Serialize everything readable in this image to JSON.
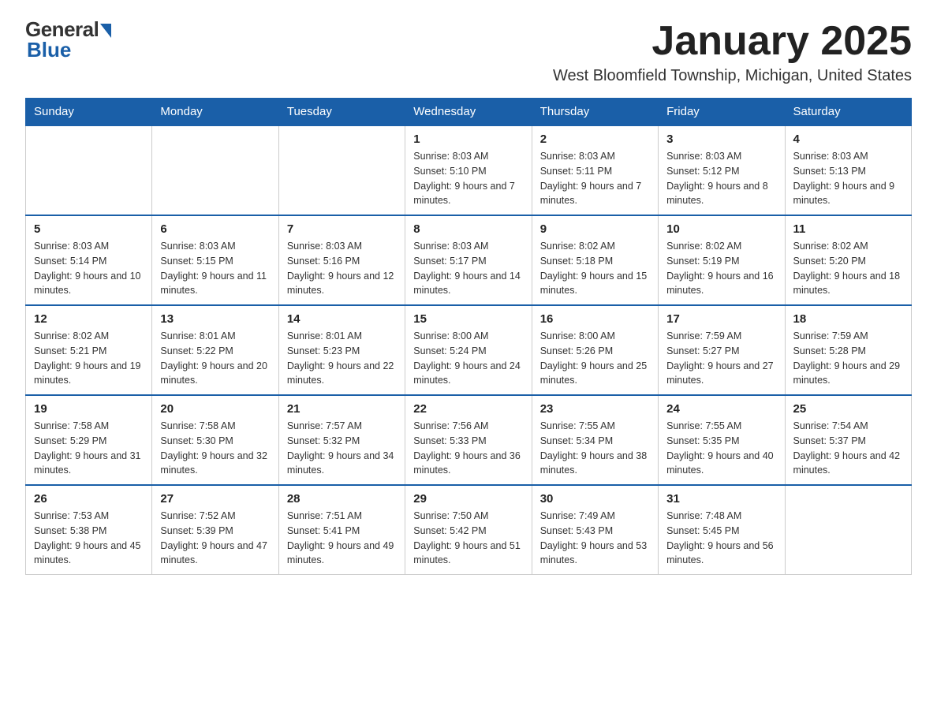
{
  "logo": {
    "general": "General",
    "blue": "Blue"
  },
  "header": {
    "month_title": "January 2025",
    "location": "West Bloomfield Township, Michigan, United States"
  },
  "days_of_week": [
    "Sunday",
    "Monday",
    "Tuesday",
    "Wednesday",
    "Thursday",
    "Friday",
    "Saturday"
  ],
  "weeks": [
    [
      {
        "day": "",
        "info": ""
      },
      {
        "day": "",
        "info": ""
      },
      {
        "day": "",
        "info": ""
      },
      {
        "day": "1",
        "info": "Sunrise: 8:03 AM\nSunset: 5:10 PM\nDaylight: 9 hours and 7 minutes."
      },
      {
        "day": "2",
        "info": "Sunrise: 8:03 AM\nSunset: 5:11 PM\nDaylight: 9 hours and 7 minutes."
      },
      {
        "day": "3",
        "info": "Sunrise: 8:03 AM\nSunset: 5:12 PM\nDaylight: 9 hours and 8 minutes."
      },
      {
        "day": "4",
        "info": "Sunrise: 8:03 AM\nSunset: 5:13 PM\nDaylight: 9 hours and 9 minutes."
      }
    ],
    [
      {
        "day": "5",
        "info": "Sunrise: 8:03 AM\nSunset: 5:14 PM\nDaylight: 9 hours and 10 minutes."
      },
      {
        "day": "6",
        "info": "Sunrise: 8:03 AM\nSunset: 5:15 PM\nDaylight: 9 hours and 11 minutes."
      },
      {
        "day": "7",
        "info": "Sunrise: 8:03 AM\nSunset: 5:16 PM\nDaylight: 9 hours and 12 minutes."
      },
      {
        "day": "8",
        "info": "Sunrise: 8:03 AM\nSunset: 5:17 PM\nDaylight: 9 hours and 14 minutes."
      },
      {
        "day": "9",
        "info": "Sunrise: 8:02 AM\nSunset: 5:18 PM\nDaylight: 9 hours and 15 minutes."
      },
      {
        "day": "10",
        "info": "Sunrise: 8:02 AM\nSunset: 5:19 PM\nDaylight: 9 hours and 16 minutes."
      },
      {
        "day": "11",
        "info": "Sunrise: 8:02 AM\nSunset: 5:20 PM\nDaylight: 9 hours and 18 minutes."
      }
    ],
    [
      {
        "day": "12",
        "info": "Sunrise: 8:02 AM\nSunset: 5:21 PM\nDaylight: 9 hours and 19 minutes."
      },
      {
        "day": "13",
        "info": "Sunrise: 8:01 AM\nSunset: 5:22 PM\nDaylight: 9 hours and 20 minutes."
      },
      {
        "day": "14",
        "info": "Sunrise: 8:01 AM\nSunset: 5:23 PM\nDaylight: 9 hours and 22 minutes."
      },
      {
        "day": "15",
        "info": "Sunrise: 8:00 AM\nSunset: 5:24 PM\nDaylight: 9 hours and 24 minutes."
      },
      {
        "day": "16",
        "info": "Sunrise: 8:00 AM\nSunset: 5:26 PM\nDaylight: 9 hours and 25 minutes."
      },
      {
        "day": "17",
        "info": "Sunrise: 7:59 AM\nSunset: 5:27 PM\nDaylight: 9 hours and 27 minutes."
      },
      {
        "day": "18",
        "info": "Sunrise: 7:59 AM\nSunset: 5:28 PM\nDaylight: 9 hours and 29 minutes."
      }
    ],
    [
      {
        "day": "19",
        "info": "Sunrise: 7:58 AM\nSunset: 5:29 PM\nDaylight: 9 hours and 31 minutes."
      },
      {
        "day": "20",
        "info": "Sunrise: 7:58 AM\nSunset: 5:30 PM\nDaylight: 9 hours and 32 minutes."
      },
      {
        "day": "21",
        "info": "Sunrise: 7:57 AM\nSunset: 5:32 PM\nDaylight: 9 hours and 34 minutes."
      },
      {
        "day": "22",
        "info": "Sunrise: 7:56 AM\nSunset: 5:33 PM\nDaylight: 9 hours and 36 minutes."
      },
      {
        "day": "23",
        "info": "Sunrise: 7:55 AM\nSunset: 5:34 PM\nDaylight: 9 hours and 38 minutes."
      },
      {
        "day": "24",
        "info": "Sunrise: 7:55 AM\nSunset: 5:35 PM\nDaylight: 9 hours and 40 minutes."
      },
      {
        "day": "25",
        "info": "Sunrise: 7:54 AM\nSunset: 5:37 PM\nDaylight: 9 hours and 42 minutes."
      }
    ],
    [
      {
        "day": "26",
        "info": "Sunrise: 7:53 AM\nSunset: 5:38 PM\nDaylight: 9 hours and 45 minutes."
      },
      {
        "day": "27",
        "info": "Sunrise: 7:52 AM\nSunset: 5:39 PM\nDaylight: 9 hours and 47 minutes."
      },
      {
        "day": "28",
        "info": "Sunrise: 7:51 AM\nSunset: 5:41 PM\nDaylight: 9 hours and 49 minutes."
      },
      {
        "day": "29",
        "info": "Sunrise: 7:50 AM\nSunset: 5:42 PM\nDaylight: 9 hours and 51 minutes."
      },
      {
        "day": "30",
        "info": "Sunrise: 7:49 AM\nSunset: 5:43 PM\nDaylight: 9 hours and 53 minutes."
      },
      {
        "day": "31",
        "info": "Sunrise: 7:48 AM\nSunset: 5:45 PM\nDaylight: 9 hours and 56 minutes."
      },
      {
        "day": "",
        "info": ""
      }
    ]
  ]
}
